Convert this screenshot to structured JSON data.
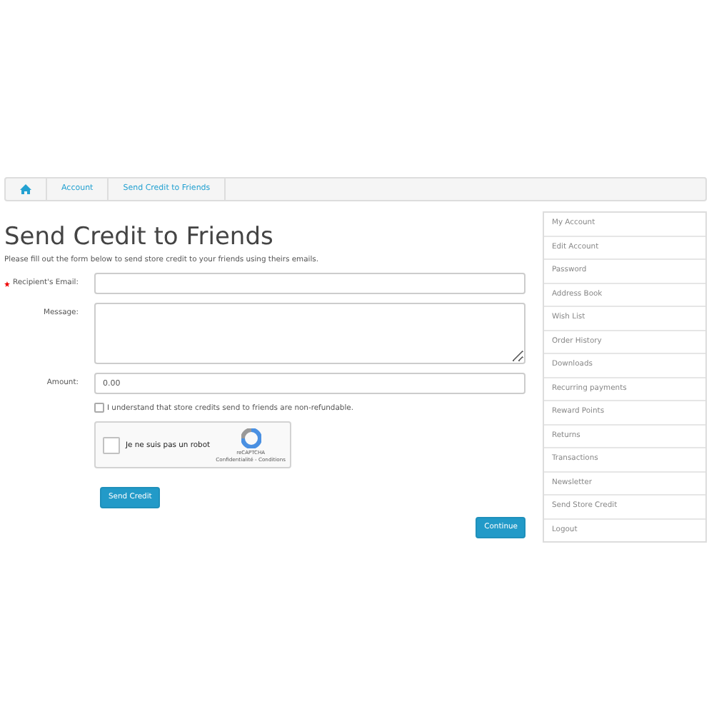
{
  "breadcrumb": [
    {
      "kind": "home"
    },
    {
      "kind": "link",
      "label": "Account"
    },
    {
      "kind": "link",
      "label": "Send Credit to Friends"
    }
  ],
  "title": "Send Credit to Friends",
  "intro": "Please fill out the form below to send store credit to your friends using theirs emails.",
  "fields": [
    {
      "kind": "input",
      "label": "Recipient's Email:",
      "required": true
    },
    {
      "kind": "textarea",
      "label": "Message:",
      "required": false
    },
    {
      "kind": "input",
      "label": "Amount:",
      "required": false,
      "value": "0.00"
    }
  ],
  "agree": {
    "label": "I understand that store credits send to friends are non-refundable.",
    "checked": false
  },
  "captcha": {
    "label": "Je ne suis pas un robot",
    "checked": false,
    "brand": "reCAPTCHA",
    "links": "Confidentialité - Conditions"
  },
  "send_button": "Send Credit",
  "continue_button": "Continue",
  "sidebar": {
    "items": [
      "My Account",
      "Edit Account",
      "Password",
      "Address Book",
      "Wish List",
      "Order History",
      "Downloads",
      "Recurring payments",
      "Reward Points",
      "Returns",
      "Transactions",
      "Newsletter",
      "Send Store Credit",
      "Logout"
    ]
  }
}
